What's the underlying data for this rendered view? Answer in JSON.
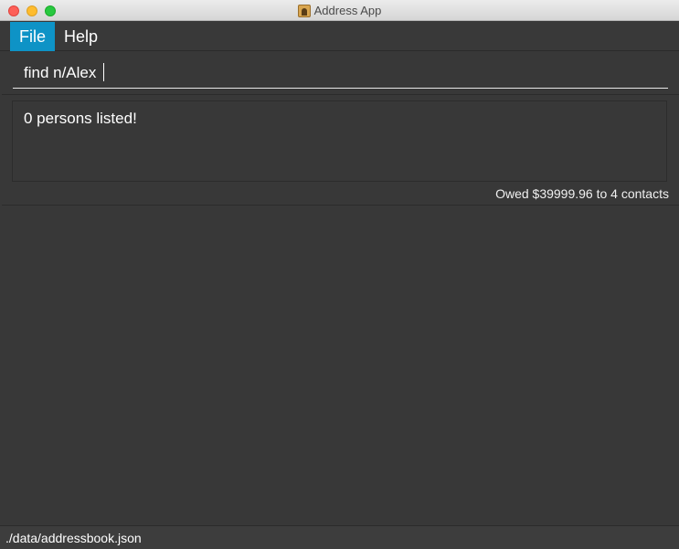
{
  "window": {
    "title": "Address App",
    "app_icon": "address-book-icon"
  },
  "menubar": {
    "items": [
      {
        "label": "File",
        "selected": true
      },
      {
        "label": "Help",
        "selected": false
      }
    ]
  },
  "command": {
    "value": "find n/Alex"
  },
  "result": {
    "message": "0 persons listed!"
  },
  "summary": {
    "owed_text": "Owed $39999.96 to 4 contacts"
  },
  "status": {
    "file_path": "./data/addressbook.json"
  },
  "colors": {
    "accent": "#0e93c6",
    "background": "#383838"
  }
}
